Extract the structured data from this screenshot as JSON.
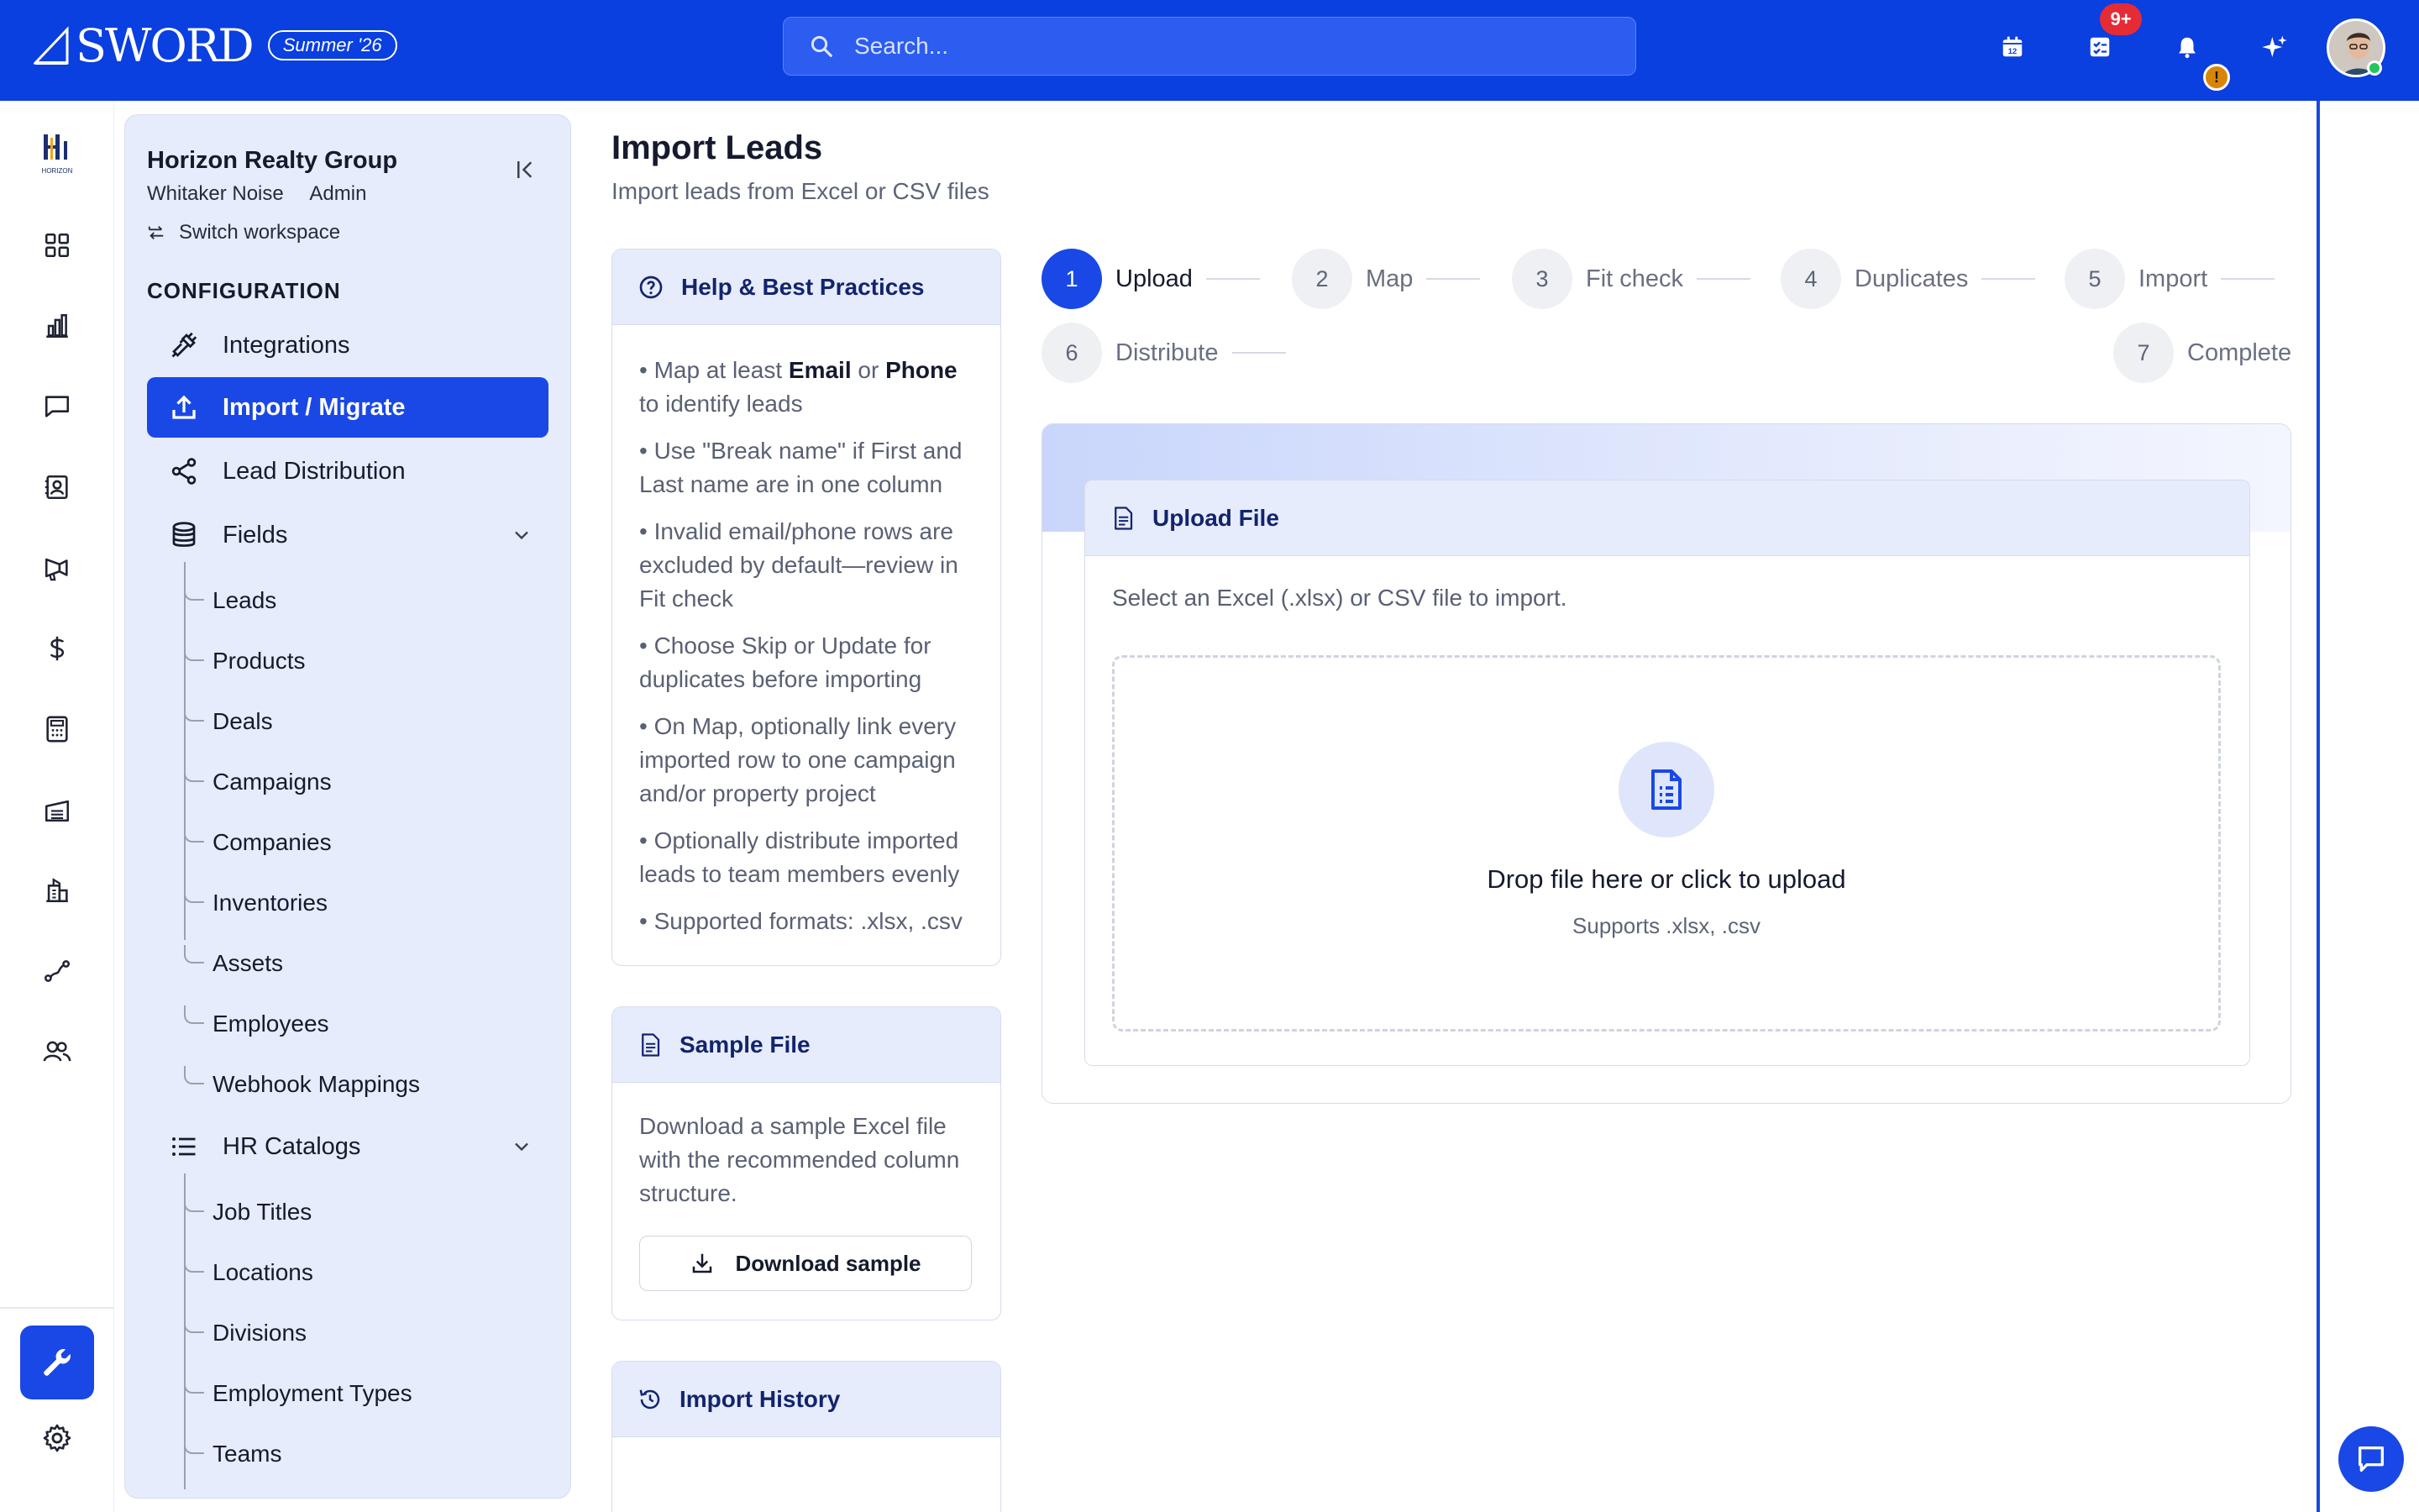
{
  "topbar": {
    "logo_text": "SWORD",
    "season": "Summer '26",
    "search_placeholder": "Search...",
    "calendar_day": "12",
    "tasks_badge": "9+",
    "alert_badge": "!"
  },
  "workspace": {
    "org_name": "Horizon Realty Group",
    "user_name": "Whitaker Noise",
    "role": "Admin",
    "switch_label": "Switch workspace",
    "rail_logo_caption": "HORIZON"
  },
  "config": {
    "heading": "CONFIGURATION",
    "nav": [
      {
        "label": "Integrations",
        "icon": "plug-icon"
      },
      {
        "label": "Import / Migrate",
        "icon": "upload-icon",
        "active": true
      },
      {
        "label": "Lead Distribution",
        "icon": "share-icon"
      },
      {
        "label": "Fields",
        "icon": "database-icon"
      },
      {
        "label": "HR Catalogs",
        "icon": "list-icon"
      }
    ],
    "fields_children": [
      "Leads",
      "Products",
      "Deals",
      "Campaigns",
      "Companies",
      "Inventories",
      "Assets",
      "Employees",
      "Webhook Mappings"
    ],
    "hr_children": [
      "Job Titles",
      "Locations",
      "Divisions",
      "Employment Types",
      "Teams"
    ]
  },
  "page": {
    "title": "Import Leads",
    "subtitle": "Import leads from Excel or CSV files"
  },
  "help": {
    "title": "Help & Best Practices",
    "tip1_pre": "• Map at least ",
    "tip1_b1": "Email",
    "tip1_mid": " or ",
    "tip1_b2": "Phone",
    "tip1_post": " to identify leads",
    "tips": [
      "• Use \"Break name\" if First and Last name are in one column",
      "• Invalid email/phone rows are excluded by default—review in Fit check",
      "• Choose Skip or Update for duplicates before importing",
      "• On Map, optionally link every imported row to one campaign and/or property project",
      "• Optionally distribute imported leads to team members evenly",
      "• Supported formats: .xlsx, .csv"
    ]
  },
  "sample": {
    "title": "Sample File",
    "text": "Download a sample Excel file with the recommended column structure.",
    "button": "Download sample"
  },
  "history": {
    "title": "Import History"
  },
  "steps": [
    {
      "num": "1",
      "label": "Upload",
      "active": true
    },
    {
      "num": "2",
      "label": "Map"
    },
    {
      "num": "3",
      "label": "Fit check"
    },
    {
      "num": "4",
      "label": "Duplicates"
    },
    {
      "num": "5",
      "label": "Import"
    },
    {
      "num": "6",
      "label": "Distribute"
    },
    {
      "num": "7",
      "label": "Complete"
    }
  ],
  "upload": {
    "title": "Upload File",
    "description": "Select an Excel (.xlsx) or CSV file to import.",
    "drop_title": "Drop file here or click to upload",
    "drop_sub": "Supports .xlsx, .csv"
  },
  "colors": {
    "brand_blue": "#0a3fe0",
    "active_blue": "#1a48e6",
    "panel_bg": "#e6ecfc",
    "badge_red": "#e52b36"
  }
}
